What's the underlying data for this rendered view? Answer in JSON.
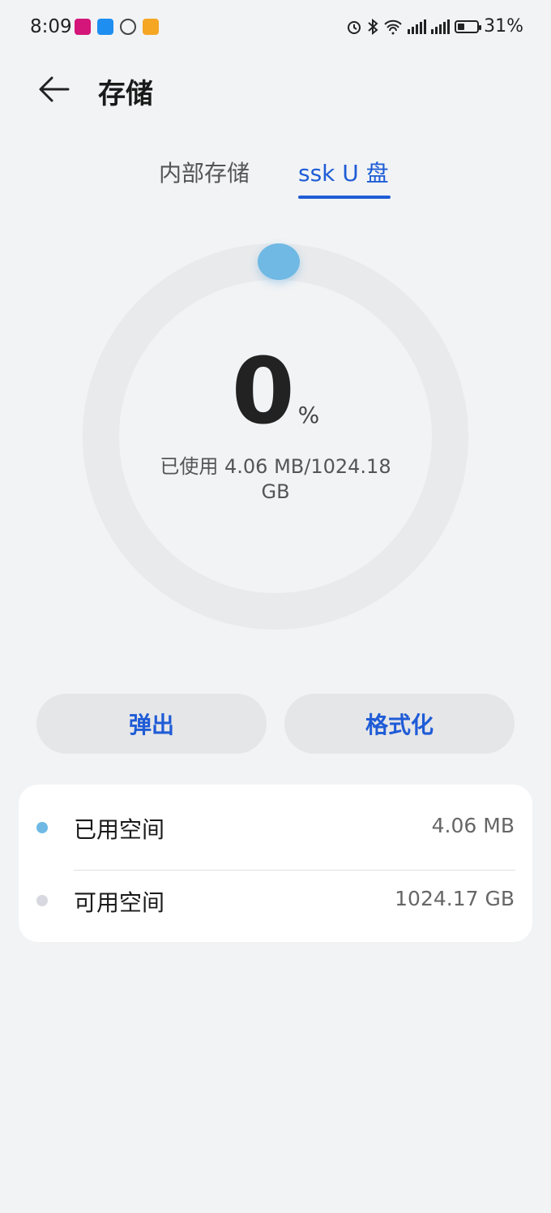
{
  "status_bar": {
    "time": "8:09",
    "battery_percent_text": "31%",
    "battery_level": 0.31,
    "icons": [
      "alarm-icon",
      "bluetooth-icon",
      "wifi-icon",
      "signal-4g-icon",
      "signal-4g-icon",
      "battery-icon"
    ],
    "notification_icon_colors": [
      "#d4157a",
      "#1e8ef0",
      "#444444",
      "#f5a623"
    ]
  },
  "header": {
    "title": "存储"
  },
  "tabs": [
    {
      "label": "内部存储",
      "active": false
    },
    {
      "label": "ssk U 盘",
      "active": true
    }
  ],
  "gauge": {
    "percent": "0",
    "percent_sign": "%",
    "usage_text": "已使用 4.06 MB/1024.18 GB"
  },
  "actions": {
    "eject_label": "弹出",
    "format_label": "格式化"
  },
  "storage_items": [
    {
      "label": "已用空间",
      "value": "4.06 MB",
      "color": "#6fb9e4"
    },
    {
      "label": "可用空间",
      "value": "1024.17 GB",
      "color": "#d8d8e0"
    }
  ],
  "colors": {
    "accent": "#1f5cd6",
    "background": "#f1f3f5"
  }
}
